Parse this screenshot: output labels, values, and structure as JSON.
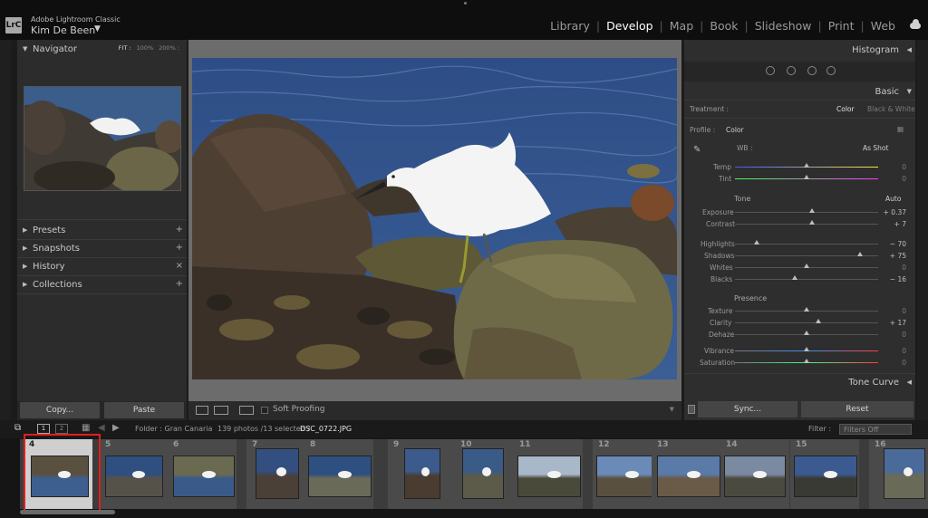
{
  "topbar": {
    "logo": "LrC",
    "app_name": "Adobe Lightroom Classic",
    "user": "Kim De Been",
    "modules": [
      "Library",
      "Develop",
      "Map",
      "Book",
      "Slideshow",
      "Print",
      "Web"
    ],
    "active_module": "Develop"
  },
  "left_panel": {
    "navigator": {
      "title": "Navigator",
      "zoom_options": [
        "FIT :",
        "100%",
        "200% :"
      ]
    },
    "sections": [
      {
        "label": "Presets",
        "action": "+"
      },
      {
        "label": "Snapshots",
        "action": "+"
      },
      {
        "label": "History",
        "action": "×"
      },
      {
        "label": "Collections",
        "action": "+"
      }
    ],
    "copy_label": "Copy...",
    "paste_label": "Paste"
  },
  "center_toolbar": {
    "soft_proofing": "Soft Proofing"
  },
  "right_panel": {
    "histogram": "Histogram",
    "basic": "Basic",
    "treatment_label": "Treatment :",
    "treatment_options": [
      "Color",
      "Black & White"
    ],
    "treatment_selected": "Color",
    "profile_label": "Profile :",
    "profile_value": "Color",
    "wb_label": "WB :",
    "wb_value": "As Shot",
    "temp": {
      "label": "Temp",
      "value": "0",
      "position": 0.5
    },
    "tint": {
      "label": "Tint",
      "value": "0",
      "position": 0.5
    },
    "tone_label": "Tone",
    "auto_label": "Auto",
    "exposure": {
      "label": "Exposure",
      "value": "+ 0.37",
      "position": 0.537
    },
    "contrast": {
      "label": "Contrast",
      "value": "+ 7",
      "position": 0.535
    },
    "highlights": {
      "label": "Highlights",
      "value": "− 70",
      "position": 0.15
    },
    "shadows": {
      "label": "Shadows",
      "value": "+ 75",
      "position": 0.875
    },
    "whites": {
      "label": "Whites",
      "value": "0",
      "position": 0.5
    },
    "blacks": {
      "label": "Blacks",
      "value": "− 16",
      "position": 0.42
    },
    "presence_label": "Presence",
    "texture": {
      "label": "Texture",
      "value": "0",
      "position": 0.5
    },
    "clarity": {
      "label": "Clarity",
      "value": "+ 17",
      "position": 0.585
    },
    "dehaze": {
      "label": "Dehaze",
      "value": "0",
      "position": 0.5
    },
    "vibrance": {
      "label": "Vibrance",
      "value": "0",
      "position": 0.5
    },
    "saturation": {
      "label": "Saturation",
      "value": "0",
      "position": 0.5
    },
    "tone_curve": "Tone Curve",
    "sync_label": "Sync...",
    "reset_label": "Reset"
  },
  "filmstrip_bar": {
    "page1": "1",
    "page2": "2",
    "folder": "Folder : Gran Canaria",
    "count": "139 photos /13 selected /",
    "filename": "DSC_0722.JPG",
    "filter_label": "Filter :",
    "filter_value": "Filters Off"
  },
  "filmstrip": {
    "numbers": [
      "4",
      "5",
      "6",
      "7",
      "8",
      "9",
      "10",
      "11",
      "12",
      "13",
      "14",
      "15",
      "16"
    ],
    "selected_index": 0
  }
}
